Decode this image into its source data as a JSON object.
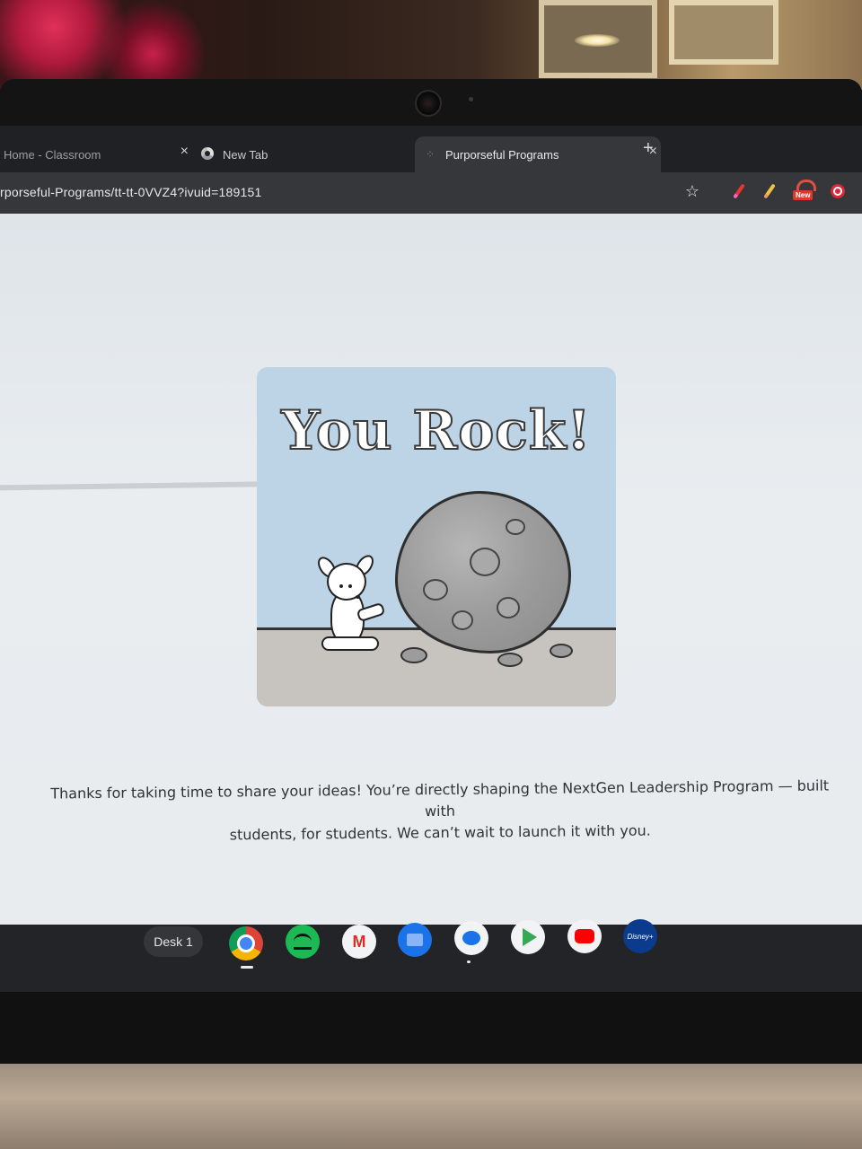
{
  "browser": {
    "tabs": [
      {
        "label": "Home - Classroom",
        "active": false
      },
      {
        "label": "New Tab",
        "active": false
      },
      {
        "label": "Purporseful Programs",
        "active": true
      }
    ],
    "close_glyph": "×",
    "new_tab_glyph": "+",
    "url": "rporseful-Programs/tt-tt-0VVZ4?ivuid=189151",
    "toolbar": {
      "star_glyph": "☆",
      "new_badge": "New"
    }
  },
  "page": {
    "image_title": "You Rock!",
    "message_line1": "Thanks for taking  time to share your ideas! You’re directly shaping the NextGen Leadership Program — built with",
    "message_line2": "students, for students. We can’t wait to launch it with you."
  },
  "shelf": {
    "desk_label": "Desk 1",
    "gmail_glyph": "M",
    "disney_label": "Disney+",
    "apps": [
      "chrome-icon",
      "spotify-icon",
      "gmail-icon",
      "files-icon",
      "messages-icon",
      "play-store-icon",
      "youtube-icon",
      "disney-plus-icon"
    ]
  }
}
